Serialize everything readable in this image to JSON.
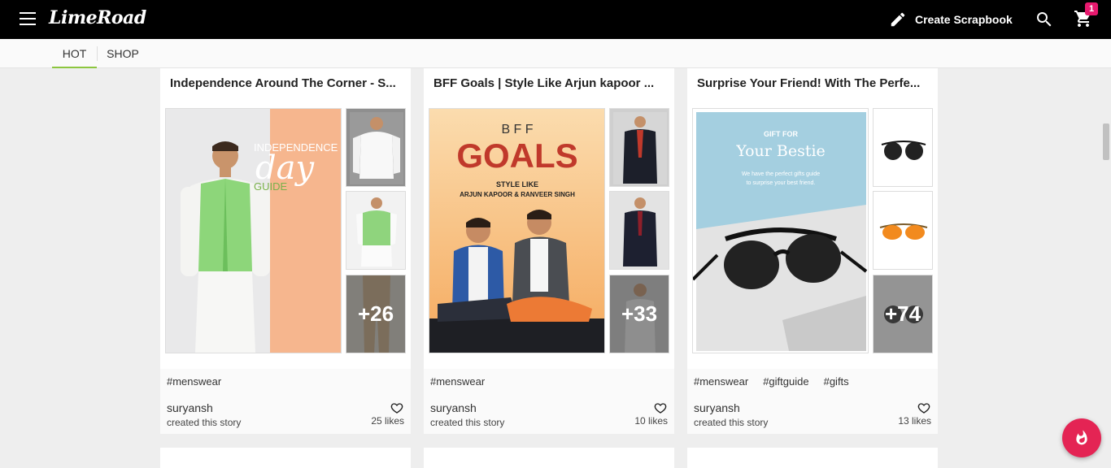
{
  "header": {
    "logo": "LimeRoad",
    "create_scrapbook": "Create Scrapbook",
    "cart_count": "1"
  },
  "tabs": [
    {
      "label": "HOT",
      "active": true
    },
    {
      "label": "SHOP",
      "active": false
    }
  ],
  "cards": [
    {
      "title": "Independence Around The Corner - S...",
      "banner": {
        "line1": "INDEPENDENCE",
        "line2": "day",
        "line3": "GUIDE"
      },
      "more": "+26",
      "tags": [
        "#menswear"
      ],
      "author": "suryansh",
      "created_text": "created this story",
      "likes": "25 likes"
    },
    {
      "title": "BFF Goals | Style Like Arjun kapoor ...",
      "banner": {
        "line1": "B F F",
        "line2": "GOALS",
        "line3": "STYLE LIKE",
        "line4": "ARJUN KAPOOR & RANVEER SINGH"
      },
      "more": "+33",
      "tags": [
        "#menswear"
      ],
      "author": "suryansh",
      "created_text": "created this story",
      "likes": "10 likes"
    },
    {
      "title": "Surprise Your Friend! With The Perfe...",
      "banner": {
        "line1": "GIFT FOR",
        "line2": "Your Bestie",
        "line3": "We have the perfect gifts guide",
        "line4": "to surprise your best friend."
      },
      "more": "+74",
      "tags": [
        "#menswear",
        "#giftguide",
        "#gifts"
      ],
      "author": "suryansh",
      "created_text": "created this story",
      "likes": "13 likes"
    }
  ],
  "colors": {
    "topbar": "#000000",
    "active_tab_underline": "#8cc63f",
    "badge": "#e7196e",
    "fab": "#e42454"
  },
  "icons": [
    "menu-icon",
    "pencil-icon",
    "search-icon",
    "cart-icon",
    "heart-icon",
    "flame-icon"
  ]
}
